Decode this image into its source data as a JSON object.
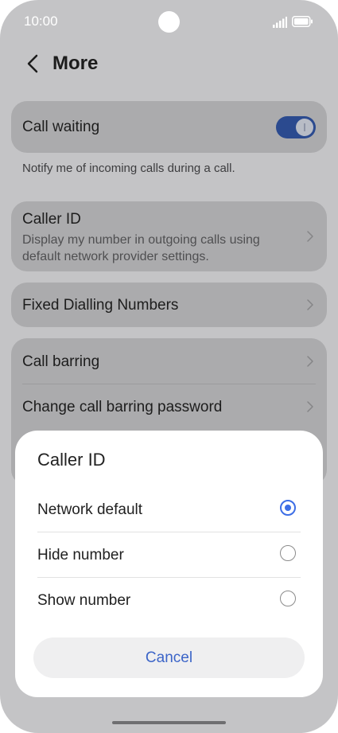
{
  "status_bar": {
    "time": "10:00",
    "signal_icon": "signal-icon",
    "battery_icon": "battery-icon"
  },
  "header": {
    "back_icon": "chevron-left-icon",
    "title": "More"
  },
  "settings": {
    "call_waiting": {
      "title": "Call waiting",
      "toggle_on": true,
      "description": "Notify me of incoming calls during a call."
    },
    "caller_id": {
      "title": "Caller ID",
      "subtitle": "Display my number in outgoing calls using default network provider settings."
    },
    "fixed_dialling": {
      "title": "Fixed Dialling Numbers"
    },
    "call_barring": {
      "title": "Call barring"
    },
    "change_barring_password": {
      "title": "Change call barring password"
    }
  },
  "dialog": {
    "title": "Caller ID",
    "options": [
      {
        "label": "Network default",
        "selected": true
      },
      {
        "label": "Hide number",
        "selected": false
      },
      {
        "label": "Show number",
        "selected": false
      }
    ],
    "cancel_label": "Cancel"
  },
  "colors": {
    "accent": "#3d6ee6",
    "toggle_track": "#2b4a8f",
    "cancel_text": "#3c65c8",
    "background_dimmed": "#c4c4c6"
  }
}
